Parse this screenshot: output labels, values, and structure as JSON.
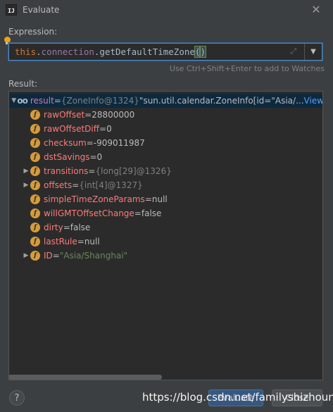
{
  "window": {
    "title": "Evaluate",
    "icon_text": "IJ"
  },
  "expression": {
    "label": "Expression:",
    "code": [
      {
        "t": "this",
        "c": "kw"
      },
      {
        "t": ".",
        "c": "mth"
      },
      {
        "t": "connection",
        "c": "fld"
      },
      {
        "t": ".getDefaultTimeZone",
        "c": "mth"
      },
      {
        "t": "(",
        "c": "paren"
      },
      {
        "t": ")",
        "c": "paren"
      }
    ],
    "hint": "Use Ctrl+Shift+Enter to add to Watches"
  },
  "result": {
    "label": "Result:",
    "rows": [
      {
        "indent": 0,
        "arrow": "▼",
        "icon": "oo",
        "name": "result",
        "eq": " = ",
        "type": "{ZoneInfo@1324} ",
        "val": "\"sun.util.calendar.ZoneInfo[id=\"Asia/...",
        "link": " View",
        "sel": true
      },
      {
        "indent": 1,
        "arrow": "",
        "icon": "f",
        "name": "rawOffset",
        "eq": " = ",
        "val": "28800000",
        "red": true
      },
      {
        "indent": 1,
        "arrow": "",
        "icon": "f",
        "name": "rawOffsetDiff",
        "eq": " = ",
        "val": "0",
        "red": true
      },
      {
        "indent": 1,
        "arrow": "",
        "icon": "f",
        "name": "checksum",
        "eq": " = ",
        "val": "-909011987",
        "red": true
      },
      {
        "indent": 1,
        "arrow": "",
        "icon": "f",
        "name": "dstSavings",
        "eq": " = ",
        "val": "0",
        "red": true
      },
      {
        "indent": 1,
        "arrow": "▶",
        "icon": "f",
        "name": "transitions",
        "eq": " = ",
        "type": "{long[29]@1326}",
        "red": true
      },
      {
        "indent": 1,
        "arrow": "▶",
        "icon": "f",
        "name": "offsets",
        "eq": " = ",
        "type": "{int[4]@1327}",
        "red": true
      },
      {
        "indent": 1,
        "arrow": "",
        "icon": "f",
        "name": "simpleTimeZoneParams",
        "eq": " = ",
        "val": "null",
        "red": true
      },
      {
        "indent": 1,
        "arrow": "",
        "icon": "f",
        "name": "willGMTOffsetChange",
        "eq": " = ",
        "val": "false",
        "red": true
      },
      {
        "indent": 1,
        "arrow": "",
        "icon": "f",
        "name": "dirty",
        "eq": " = ",
        "val": "false",
        "red": true
      },
      {
        "indent": 1,
        "arrow": "",
        "icon": "f",
        "name": "lastRule",
        "eq": " = ",
        "val": "null",
        "red": true
      },
      {
        "indent": 1,
        "arrow": "▶",
        "icon": "f",
        "name": "ID",
        "eq": " = ",
        "str": "\"Asia/Shanghai\"",
        "red": true
      }
    ]
  },
  "footer": {
    "help": "?",
    "evaluate": "Evaluate",
    "close": "Close",
    "watermark": "https://blog.csdn.net/familyshizhouna"
  },
  "colors": {
    "accent": "#4a88c7",
    "field_icon": "#d69b3a",
    "link": "#589df6",
    "string": "#6a8759"
  }
}
